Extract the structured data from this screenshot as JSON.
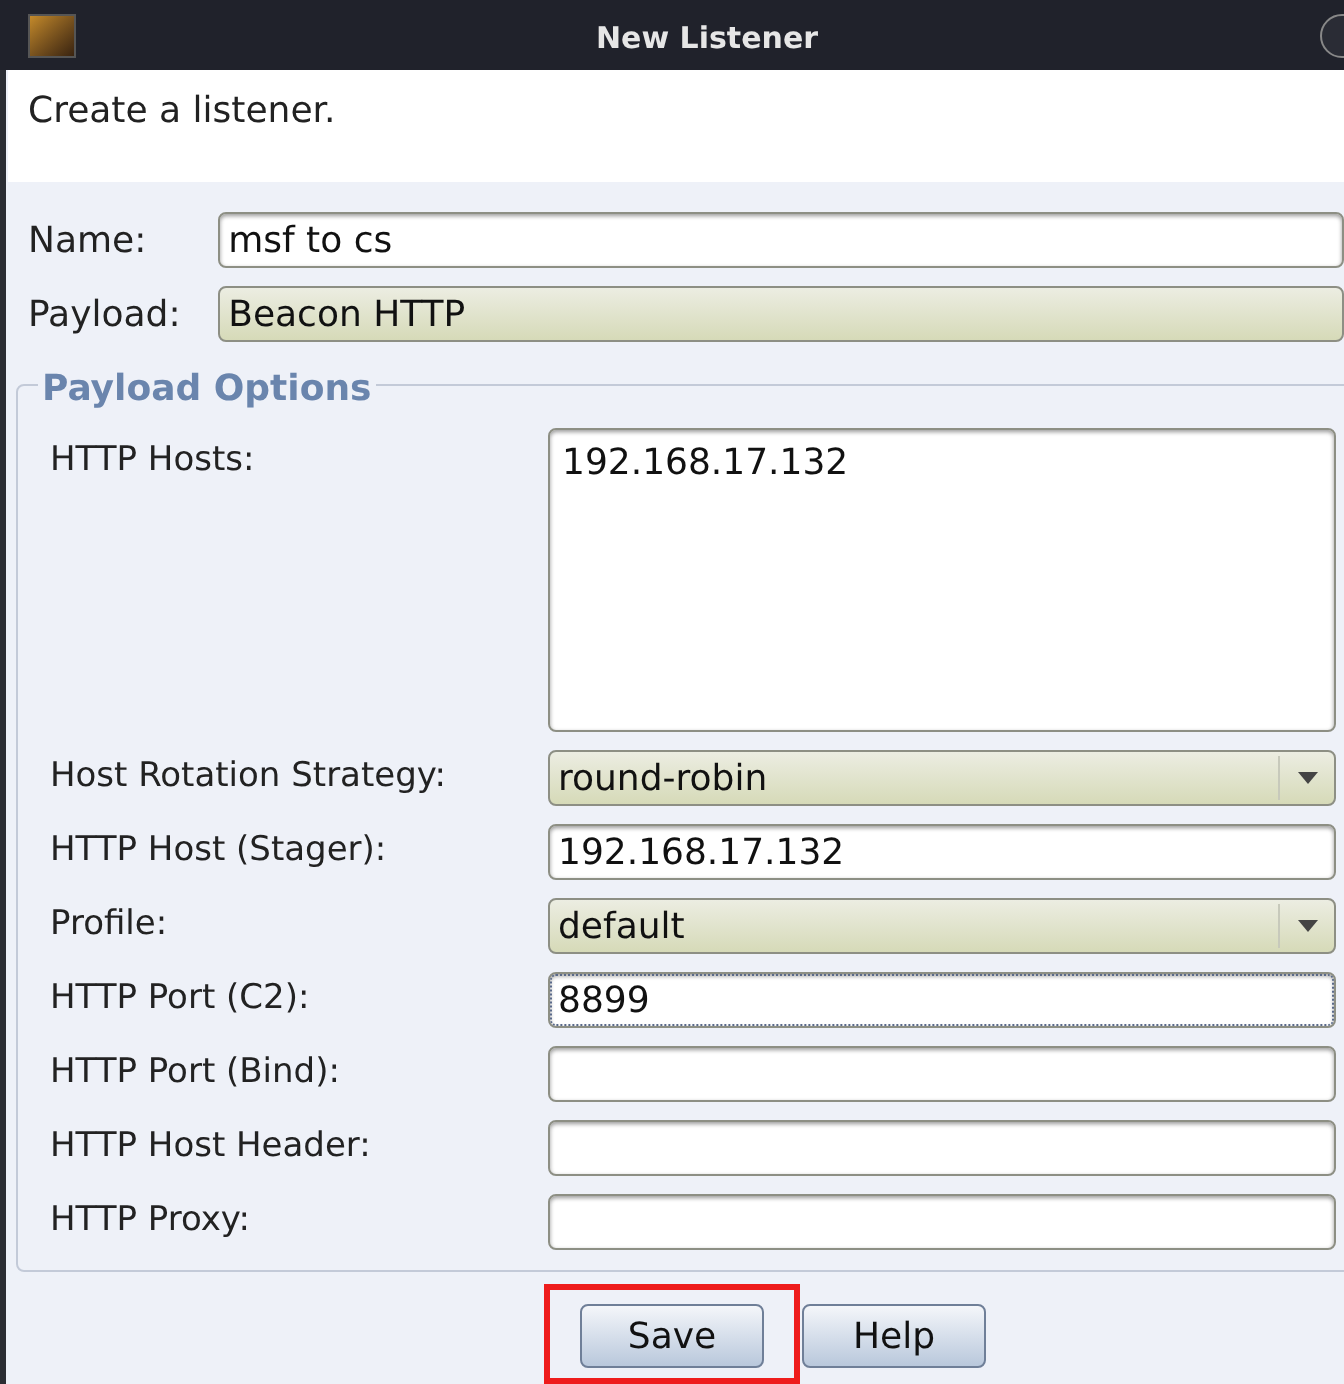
{
  "window": {
    "title": "New Listener"
  },
  "description": "Create a listener.",
  "top_fields": [
    {
      "label": "Name:",
      "kind": "text",
      "value": "msf to cs"
    },
    {
      "label": "Payload:",
      "kind": "combo",
      "value": "Beacon HTTP"
    }
  ],
  "payload_options": {
    "title": "Payload Options",
    "fields": [
      {
        "label": "HTTP Hosts:",
        "kind": "textarea",
        "value": "192.168.17.132",
        "focused": false
      },
      {
        "label": "Host Rotation Strategy:",
        "kind": "combo",
        "value": "round-robin",
        "focused": false
      },
      {
        "label": "HTTP Host (Stager):",
        "kind": "text",
        "value": "192.168.17.132",
        "focused": false
      },
      {
        "label": "Profile:",
        "kind": "combo",
        "value": "default",
        "focused": false
      },
      {
        "label": "HTTP Port (C2):",
        "kind": "text",
        "value": "8899",
        "focused": true
      },
      {
        "label": "HTTP Port (Bind):",
        "kind": "text",
        "focused": false
      },
      {
        "label": "HTTP Host Header:",
        "kind": "text",
        "focused": false
      },
      {
        "label": "HTTP Proxy:",
        "kind": "text",
        "focused": false
      }
    ]
  },
  "buttons": [
    {
      "label": "Save",
      "highlighted": true
    },
    {
      "label": "Help",
      "highlighted": false
    }
  ]
}
